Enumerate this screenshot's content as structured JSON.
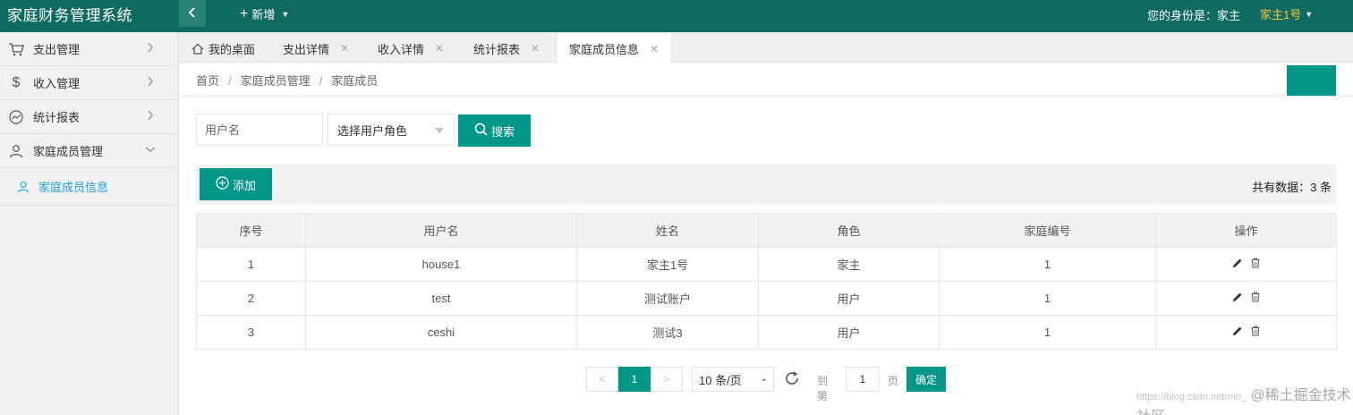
{
  "header": {
    "app_title": "家庭财务管理系统",
    "add_label": "新增",
    "identity_label": "您的身份是：家主",
    "user_name": "家主1号"
  },
  "sidebar": {
    "items": [
      {
        "label": "支出管理",
        "icon": "cart-icon"
      },
      {
        "label": "收入管理",
        "icon": "dollar-icon"
      },
      {
        "label": "统计报表",
        "icon": "chart-icon"
      },
      {
        "label": "家庭成员管理",
        "icon": "user-icon"
      }
    ],
    "sub_items": [
      {
        "label": "家庭成员信息",
        "icon": "user-icon",
        "active": true
      }
    ]
  },
  "tabs": [
    {
      "label": "我的桌面",
      "closable": false
    },
    {
      "label": "支出详情",
      "closable": true
    },
    {
      "label": "收入详情",
      "closable": true
    },
    {
      "label": "统计报表",
      "closable": true
    },
    {
      "label": "家庭成员信息",
      "closable": true,
      "active": true
    }
  ],
  "breadcrumb": [
    "首页",
    "家庭成员管理",
    "家庭成员"
  ],
  "search": {
    "username_placeholder": "用户名",
    "role_select_value": "选择用户角色",
    "search_label": "搜索"
  },
  "toolbar": {
    "add_label": "添加",
    "total_text": "共有数据：3 条"
  },
  "table": {
    "columns": [
      "序号",
      "用户名",
      "姓名",
      "角色",
      "家庭编号",
      "操作"
    ],
    "rows": [
      [
        "1",
        "house1",
        "家主1号",
        "家主",
        "1"
      ],
      [
        "2",
        "test",
        "测试账户",
        "用户",
        "1"
      ],
      [
        "3",
        "ceshi",
        "测试3",
        "用户",
        "1"
      ]
    ]
  },
  "pager": {
    "prev": "<",
    "current": "1",
    "next": ">",
    "page_size": "10 条/页",
    "goto_label": "到第",
    "goto_value": "1",
    "page_label": "页",
    "confirm_label": "确定"
  },
  "watermark": {
    "url": "https://blog.csdn.net/m0_",
    "text": "@稀土掘金技术社区"
  },
  "colors": {
    "header_bg": "#0f6b5f",
    "primary": "#009688",
    "user_name": "#f6c744",
    "active_link": "#1e9ff2"
  }
}
